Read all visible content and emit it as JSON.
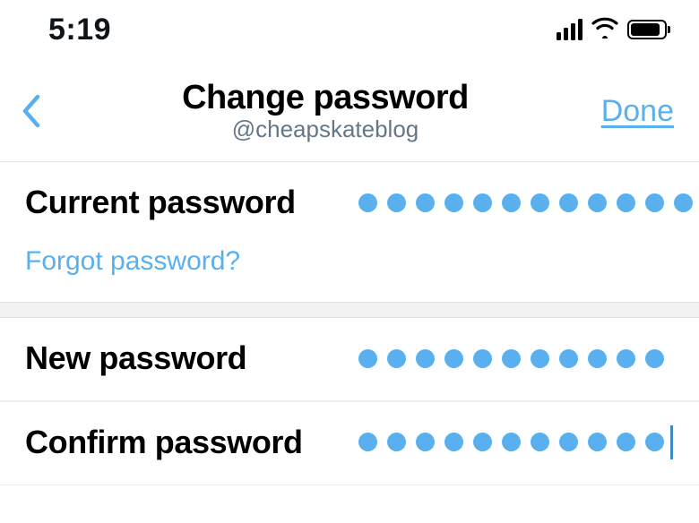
{
  "status": {
    "time": "5:19"
  },
  "header": {
    "title": "Change password",
    "handle": "@cheapskateblog",
    "done_label": "Done"
  },
  "fields": {
    "current": {
      "label": "Current password",
      "mask_count": 12
    },
    "forgot_label": "Forgot password?",
    "new": {
      "label": "New password",
      "mask_count": 11
    },
    "confirm": {
      "label": "Confirm password",
      "mask_count": 11,
      "caret": true
    }
  },
  "colors": {
    "accent": "#5ab0ee",
    "muted": "#657786"
  }
}
